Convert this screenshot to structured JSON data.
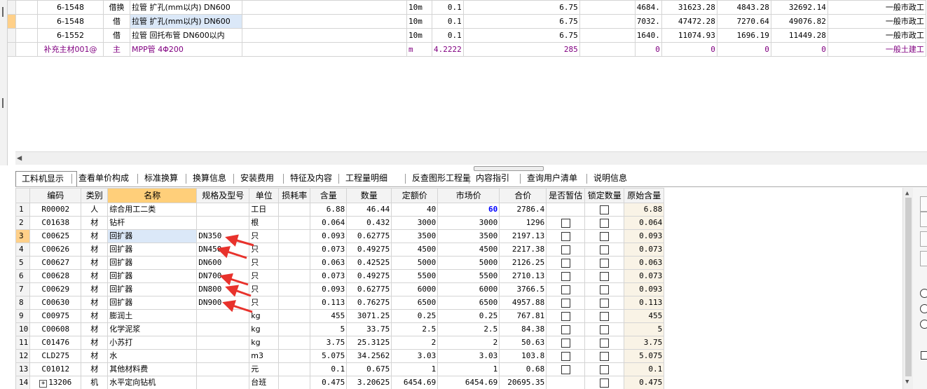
{
  "upper_rows": [
    {
      "id": "6-1548",
      "type": "借换",
      "name": "拉管 扩孔(mm以内) DN600",
      "unit": "10m",
      "qty": "0.1",
      "v1": "6.75",
      "v2": "4684.",
      "v3": "31623.28",
      "v4": "4843.28",
      "v5": "32692.14",
      "cat": "一般市政工"
    },
    {
      "id": "6-1548",
      "type": "借",
      "name": "拉管 扩孔(mm以内) DN600",
      "unit": "10m",
      "qty": "0.1",
      "v1": "6.75",
      "v2": "7032.",
      "v3": "47472.28",
      "v4": "7270.64",
      "v5": "49076.82",
      "cat": "一般市政工"
    },
    {
      "id": "6-1552",
      "type": "借",
      "name": "拉管 回托布管 DN600以内",
      "unit": "10m",
      "qty": "0.1",
      "v1": "6.75",
      "v2": "1640.",
      "v3": "11074.93",
      "v4": "1696.19",
      "v5": "11449.28",
      "cat": "一般市政工"
    },
    {
      "id": "补充主材001@",
      "type": "主",
      "name": "MPP管 4Φ200",
      "unit": "m",
      "qty": "4.2222",
      "v1": "285",
      "v2": "0",
      "v3": "0",
      "v4": "0",
      "v5": "0",
      "cat": "一般土建工"
    }
  ],
  "tabs": [
    "工料机显示",
    "查看单价构成",
    "标准换算",
    "换算信息",
    "安装费用",
    "特征及内容",
    "工程量明细",
    "反查图形工程量",
    "内容指引",
    "查询用户清单",
    "说明信息"
  ],
  "columns": [
    "编码",
    "类别",
    "名称",
    "规格及型号",
    "单位",
    "损耗率",
    "含量",
    "数量",
    "定额价",
    "市场价",
    "合价",
    "是否暂估",
    "锁定数量",
    "原始含量"
  ],
  "rows": [
    {
      "n": "1",
      "code": "R00002",
      "cat": "人",
      "name": "综合用工二类",
      "spec": "",
      "unit": "工日",
      "loss": "",
      "content": "6.88",
      "qty": "46.44",
      "price": "40",
      "market": "60",
      "total": "2786.4",
      "est": false,
      "lock": true,
      "orig": "6.88"
    },
    {
      "n": "2",
      "code": "C01638",
      "cat": "材",
      "name": "钻杆",
      "spec": "",
      "unit": "根",
      "loss": "",
      "content": "0.064",
      "qty": "0.432",
      "price": "3000",
      "market": "3000",
      "total": "1296",
      "est": true,
      "lock": true,
      "orig": "0.064"
    },
    {
      "n": "3",
      "code": "C00625",
      "cat": "材",
      "name": "回扩器",
      "spec": "DN350",
      "unit": "只",
      "loss": "",
      "content": "0.093",
      "qty": "0.62775",
      "price": "3500",
      "market": "3500",
      "total": "2197.13",
      "est": true,
      "lock": true,
      "orig": "0.093"
    },
    {
      "n": "4",
      "code": "C00626",
      "cat": "材",
      "name": "回扩器",
      "spec": "DN450",
      "unit": "只",
      "loss": "",
      "content": "0.073",
      "qty": "0.49275",
      "price": "4500",
      "market": "4500",
      "total": "2217.38",
      "est": true,
      "lock": true,
      "orig": "0.073"
    },
    {
      "n": "5",
      "code": "C00627",
      "cat": "材",
      "name": "回扩器",
      "spec": "DN600",
      "unit": "只",
      "loss": "",
      "content": "0.063",
      "qty": "0.42525",
      "price": "5000",
      "market": "5000",
      "total": "2126.25",
      "est": true,
      "lock": true,
      "orig": "0.063"
    },
    {
      "n": "6",
      "code": "C00628",
      "cat": "材",
      "name": "回扩器",
      "spec": "DN700",
      "unit": "只",
      "loss": "",
      "content": "0.073",
      "qty": "0.49275",
      "price": "5500",
      "market": "5500",
      "total": "2710.13",
      "est": true,
      "lock": true,
      "orig": "0.073"
    },
    {
      "n": "7",
      "code": "C00629",
      "cat": "材",
      "name": "回扩器",
      "spec": "DN800",
      "unit": "只",
      "loss": "",
      "content": "0.093",
      "qty": "0.62775",
      "price": "6000",
      "market": "6000",
      "total": "3766.5",
      "est": true,
      "lock": true,
      "orig": "0.093"
    },
    {
      "n": "8",
      "code": "C00630",
      "cat": "材",
      "name": "回扩器",
      "spec": "DN900",
      "unit": "只",
      "loss": "",
      "content": "0.113",
      "qty": "0.76275",
      "price": "6500",
      "market": "6500",
      "total": "4957.88",
      "est": true,
      "lock": true,
      "orig": "0.113"
    },
    {
      "n": "9",
      "code": "C00975",
      "cat": "材",
      "name": "膨润土",
      "spec": "",
      "unit": "kg",
      "loss": "",
      "content": "455",
      "qty": "3071.25",
      "price": "0.25",
      "market": "0.25",
      "total": "767.81",
      "est": true,
      "lock": true,
      "orig": "455"
    },
    {
      "n": "10",
      "code": "C00608",
      "cat": "材",
      "name": "化学泥浆",
      "spec": "",
      "unit": "kg",
      "loss": "",
      "content": "5",
      "qty": "33.75",
      "price": "2.5",
      "market": "2.5",
      "total": "84.38",
      "est": true,
      "lock": true,
      "orig": "5"
    },
    {
      "n": "11",
      "code": "C01476",
      "cat": "材",
      "name": "小苏打",
      "spec": "",
      "unit": "kg",
      "loss": "",
      "content": "3.75",
      "qty": "25.3125",
      "price": "2",
      "market": "2",
      "total": "50.63",
      "est": true,
      "lock": true,
      "orig": "3.75"
    },
    {
      "n": "12",
      "code": "CLD275",
      "cat": "材",
      "name": "水",
      "spec": "",
      "unit": "m3",
      "loss": "",
      "content": "5.075",
      "qty": "34.2562",
      "price": "3.03",
      "market": "3.03",
      "total": "103.8",
      "est": true,
      "lock": true,
      "orig": "5.075"
    },
    {
      "n": "13",
      "code": "C01012",
      "cat": "材",
      "name": "其他材料费",
      "spec": "",
      "unit": "元",
      "loss": "",
      "content": "0.1",
      "qty": "0.675",
      "price": "1",
      "market": "1",
      "total": "0.68",
      "est": true,
      "lock": true,
      "orig": "0.1"
    },
    {
      "n": "14",
      "code": "13206",
      "cat": "机",
      "name": "水平定向钻机",
      "spec": "",
      "unit": "台班",
      "loss": "",
      "content": "0.475",
      "qty": "3.20625",
      "price": "6454.69",
      "market": "6454.69",
      "total": "20695.35",
      "est": false,
      "lock": true,
      "orig": "0.475"
    }
  ],
  "colors": {
    "header_highlight": "#ffcf7a",
    "selected_row": "#ffd089",
    "annotation_arrow": "#e8322c",
    "market_emphasis": "#0000ff"
  }
}
